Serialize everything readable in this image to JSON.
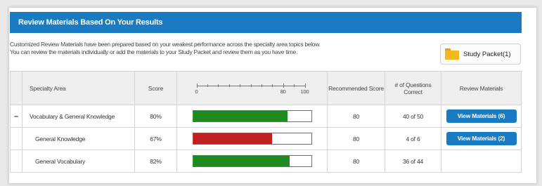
{
  "header": {
    "title": "Review Materials Based On Your Results"
  },
  "description": {
    "line1": "Customized Review Materials have been prepared based on your weakest performance across the specialty area topics below.",
    "line2": "You can review the materials individually or add the materials to your Study Packet and review them as you have time."
  },
  "study_packet": {
    "label": "Study Packet(1)",
    "icon": "folder-icon",
    "icon_color": "#f4b81f"
  },
  "table": {
    "headers": {
      "area": "Specialty Area",
      "score": "Score",
      "recommended": "Recommended Score",
      "questions": "# of Questions Correct",
      "review": "Review Materials"
    },
    "scale": {
      "min": 0,
      "recommended": 80,
      "max": 100,
      "labels": [
        "0",
        "80",
        "100"
      ]
    },
    "rows": [
      {
        "toggle": "–",
        "area": "Vocabulary & General Knowledge",
        "score": "80%",
        "percent": 80,
        "status": "pass",
        "recommended": "80",
        "questions": "40 of 50",
        "review": "View Materials  (6)"
      },
      {
        "toggle": "",
        "area": "General Knowledge",
        "score": "67%",
        "percent": 67,
        "status": "fail",
        "recommended": "80",
        "questions": "4 of 6",
        "review": "View Materials  (2)"
      },
      {
        "toggle": "",
        "area": "General Vocabulary",
        "score": "82%",
        "percent": 82,
        "status": "pass",
        "recommended": "80",
        "questions": "36 of 44",
        "review": ""
      }
    ]
  },
  "colors": {
    "header": "#1a7bc3",
    "pass_fill": "#1f8a1f",
    "pass_border": "#2f9a2f",
    "fail_fill": "#c0211c",
    "fail_border": "#d0403a",
    "button": "#1a7bc3"
  }
}
